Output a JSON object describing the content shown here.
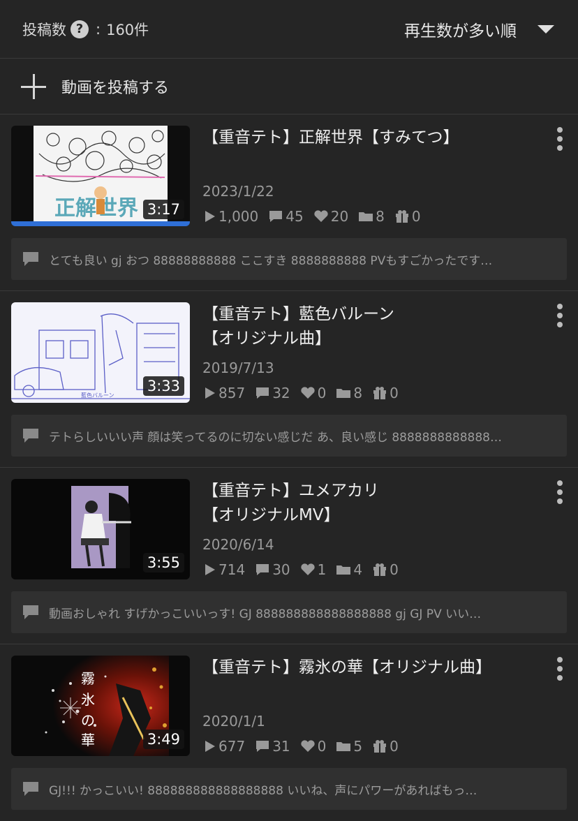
{
  "header": {
    "count_label": "投稿数",
    "count_value": "160件",
    "count_separator": ":",
    "sort_label": "再生数が多い順"
  },
  "post_button": {
    "label": "動画を投稿する"
  },
  "videos": [
    {
      "title_lines": [
        "【重音テト】正解世界【すみてつ】"
      ],
      "duration": "3:17",
      "date": "2023/1/22",
      "views": "1,000",
      "comments": "45",
      "likes": "20",
      "mylists": "8",
      "gifts": "0",
      "watched_progress": 1.0,
      "latest_comments": "とても良い gj おつ 88888888888 ここすき 8888888888 PVもすごかったです…"
    },
    {
      "title_lines": [
        "【重音テト】藍色バルーン",
        "【オリジナル曲】"
      ],
      "duration": "3:33",
      "date": "2019/7/13",
      "views": "857",
      "comments": "32",
      "likes": "0",
      "mylists": "8",
      "gifts": "0",
      "latest_comments": "テトらしいいい声 顔は笑ってるのに切ない感じだ あ、良い感じ 8888888888888…"
    },
    {
      "title_lines": [
        "【重音テト】ユメアカリ",
        "【オリジナルMV】"
      ],
      "duration": "3:55",
      "date": "2020/6/14",
      "views": "714",
      "comments": "30",
      "likes": "1",
      "mylists": "4",
      "gifts": "0",
      "latest_comments": "動画おしゃれ すげかっこいいっす! GJ 888888888888888888 gj GJ PV いい…"
    },
    {
      "title_lines": [
        "【重音テト】霧氷の華【オリジナル曲】"
      ],
      "duration": "3:49",
      "date": "2020/1/1",
      "views": "677",
      "comments": "31",
      "likes": "0",
      "mylists": "5",
      "gifts": "0",
      "latest_comments": "GJ!!! かっこいい! 888888888888888888 いいね、声にパワーがあればもっ…"
    }
  ],
  "icons": [
    "help-icon",
    "sort-caret-icon",
    "plus-icon",
    "play-icon",
    "comment-icon",
    "heart-icon",
    "folder-icon",
    "gift-icon",
    "more-vert-icon"
  ],
  "colors": {
    "background": "#252525",
    "progress": "#2f6fd6",
    "comment_box": "#303030"
  }
}
